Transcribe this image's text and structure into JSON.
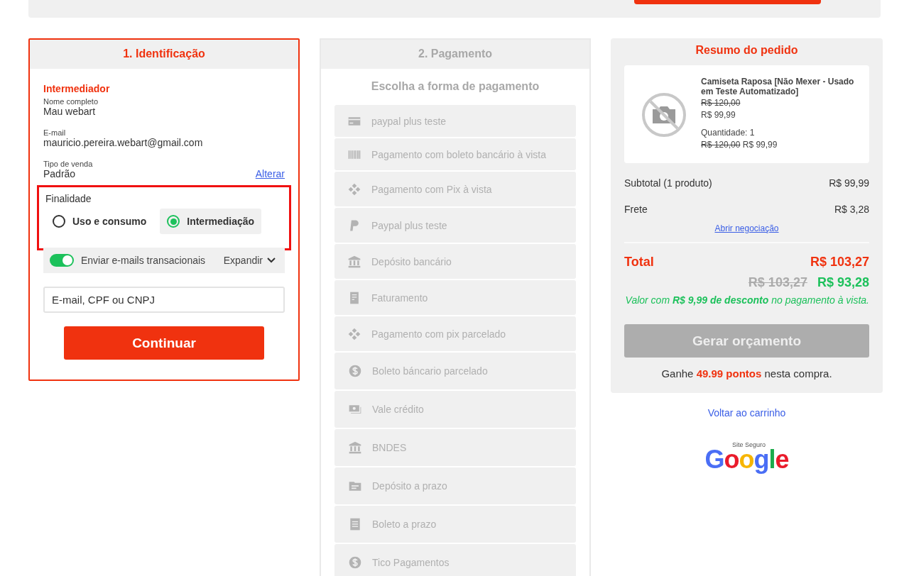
{
  "steps": [
    {
      "title": "1. Identificação",
      "active": true
    },
    {
      "title": "2. Pagamento",
      "active": false
    }
  ],
  "identification": {
    "section_title": "Intermediador",
    "fields": [
      {
        "label": "Nome completo",
        "value": "Mau webart"
      },
      {
        "label": "E-mail",
        "value": "mauricio.pereira.webart@gmail.com"
      },
      {
        "label": "Tipo de venda",
        "value": "Padrão",
        "action": "Alterar"
      }
    ],
    "purpose": {
      "label": "Finalidade",
      "highlighted": true,
      "options": [
        {
          "label": "Uso e consumo",
          "selected": false
        },
        {
          "label": "Intermediação",
          "selected": true
        }
      ]
    },
    "email_toggle": {
      "label": "Enviar e-mails transacionais",
      "on": true,
      "expand_label": "Expandir"
    },
    "search": {
      "placeholder": "E-mail, CPF ou CNPJ"
    },
    "continue_button": "Continuar"
  },
  "payment": {
    "heading": "Escolha a forma de pagamento",
    "methods": [
      {
        "kind": "card",
        "label": "paypal plus teste"
      },
      {
        "kind": "barcode",
        "label": "Pagamento com boleto bancário à vista"
      },
      {
        "kind": "pix",
        "label": "Pagamento com Pix à vista"
      },
      {
        "kind": "paypal",
        "label": "Paypal plus teste"
      },
      {
        "kind": "bank",
        "label": "Depósito bancário"
      },
      {
        "kind": "invoice",
        "label": "Faturamento"
      },
      {
        "kind": "pix",
        "label": "Pagamento com pix parcelado"
      },
      {
        "kind": "dollar",
        "label": "Boleto báncario parcelado"
      },
      {
        "kind": "money",
        "label": "Vale crédito"
      },
      {
        "kind": "bank",
        "label": "BNDES"
      },
      {
        "kind": "folder",
        "label": "Depósito a prazo"
      },
      {
        "kind": "receipt",
        "label": "Boleto a prazo"
      },
      {
        "kind": "dollar",
        "label": "Tico Pagamentos"
      }
    ]
  },
  "summary": {
    "title": "Resumo do pedido",
    "product": {
      "name": "Camiseta Raposa [Não Mexer - Usado em Teste Automatizado]",
      "old_price": "R$ 120,00",
      "price": "R$ 99,99",
      "quantity": "Quantidade: 1",
      "line_old_price": "R$ 120,00",
      "line_price": "R$ 99,99"
    },
    "rows": [
      {
        "label": "Subtotal (1 produto)",
        "value": "R$ 99,99"
      },
      {
        "label": "Frete",
        "value": "R$ 3,28"
      }
    ],
    "negotiation_link": "Abrir negociação",
    "total": {
      "label": "Total",
      "value": "R$ 103,27"
    },
    "cash": {
      "old_value": "R$ 103,27",
      "value": "R$ 93,28"
    },
    "discount_note": "Valor com **R$ 9,99 de desconto** no pagamento à vista.",
    "quote_button": {
      "label": "Gerar orçamento",
      "disabled": true
    },
    "points_note": "Ganhe **49.99 pontos** nesta compra."
  },
  "back_link": "Voltar ao carrinho",
  "seal": {
    "caption": "Site Seguro",
    "logo": "Google"
  }
}
